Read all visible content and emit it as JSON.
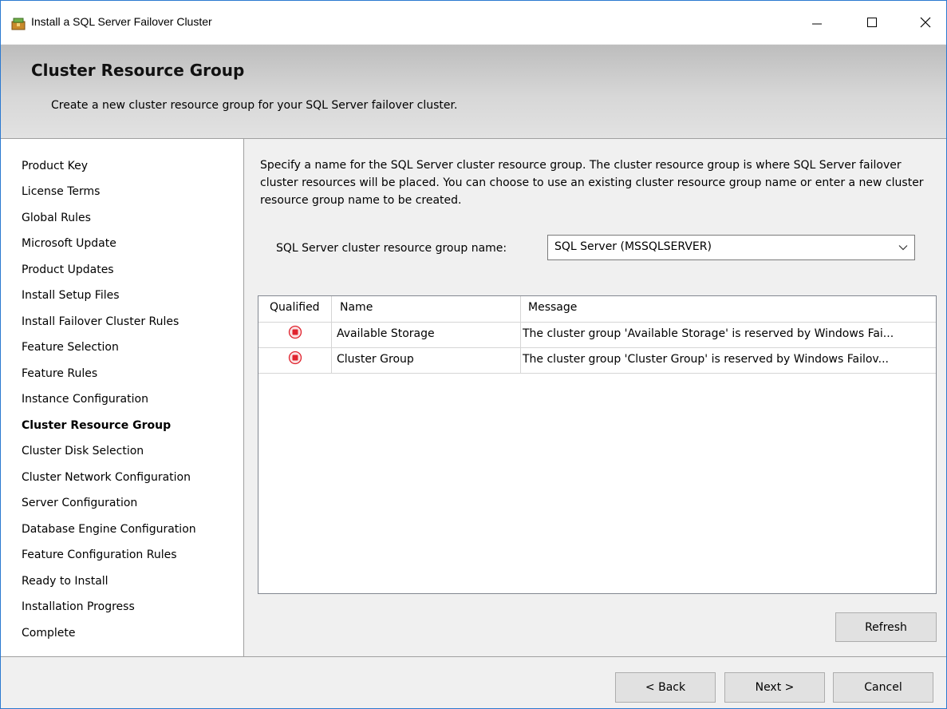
{
  "window": {
    "title": "Install a SQL Server Failover Cluster"
  },
  "header": {
    "title": "Cluster Resource Group",
    "subtitle": "Create a new cluster resource group for your SQL Server failover cluster."
  },
  "nav": {
    "items": [
      {
        "label": "Product Key",
        "active": false
      },
      {
        "label": "License Terms",
        "active": false
      },
      {
        "label": "Global Rules",
        "active": false
      },
      {
        "label": "Microsoft Update",
        "active": false
      },
      {
        "label": "Product Updates",
        "active": false
      },
      {
        "label": "Install Setup Files",
        "active": false
      },
      {
        "label": "Install Failover Cluster Rules",
        "active": false
      },
      {
        "label": "Feature Selection",
        "active": false
      },
      {
        "label": "Feature Rules",
        "active": false
      },
      {
        "label": "Instance Configuration",
        "active": false
      },
      {
        "label": "Cluster Resource Group",
        "active": true
      },
      {
        "label": "Cluster Disk Selection",
        "active": false
      },
      {
        "label": "Cluster Network Configuration",
        "active": false
      },
      {
        "label": "Server Configuration",
        "active": false
      },
      {
        "label": "Database Engine Configuration",
        "active": false
      },
      {
        "label": "Feature Configuration Rules",
        "active": false
      },
      {
        "label": "Ready to Install",
        "active": false
      },
      {
        "label": "Installation Progress",
        "active": false
      },
      {
        "label": "Complete",
        "active": false
      }
    ]
  },
  "main": {
    "description": "Specify a name for the SQL Server cluster resource group. The cluster resource group is where SQL Server failover cluster resources will be placed. You can choose to use an existing cluster resource group name or enter a new cluster resource group name to be created.",
    "group_name_label": "SQL Server cluster resource group name:",
    "group_name_value": "SQL Server (MSSQLSERVER)",
    "grid": {
      "columns": [
        "Qualified",
        "Name",
        "Message"
      ],
      "rows": [
        {
          "qualified": "error",
          "name": "Available Storage",
          "message": "The cluster group 'Available Storage' is reserved by Windows Fai..."
        },
        {
          "qualified": "error",
          "name": "Cluster Group",
          "message": "The cluster group 'Cluster Group' is reserved by Windows Failov..."
        }
      ]
    },
    "refresh_label": "Refresh"
  },
  "footer": {
    "back_label": "< Back",
    "next_label": "Next >",
    "cancel_label": "Cancel"
  },
  "colors": {
    "error_red": "#e0232e",
    "window_border": "#2b79d0"
  }
}
